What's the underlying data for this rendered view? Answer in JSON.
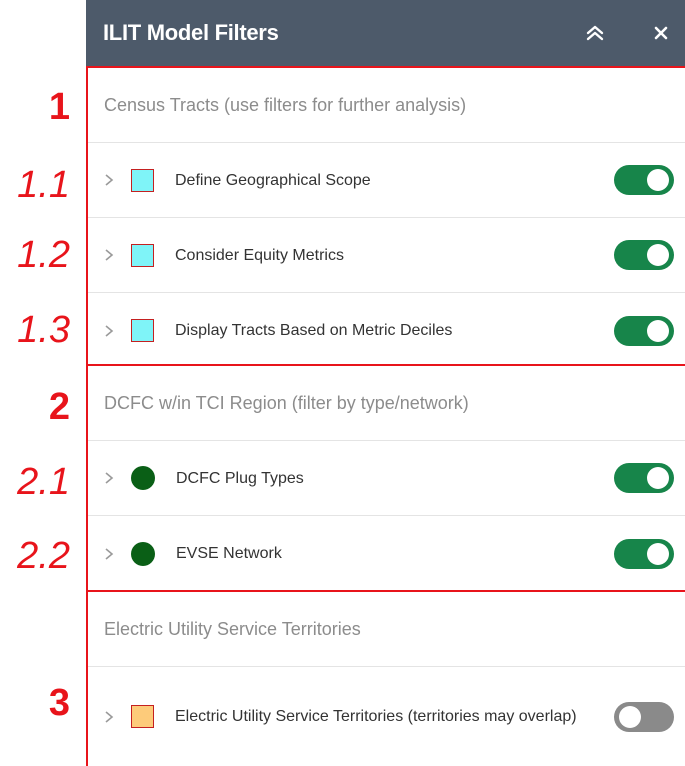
{
  "header": {
    "title": "ILIT Model Filters",
    "collapse_icon": "double-chevron-up-icon",
    "close_icon": "close-icon"
  },
  "annotations": [
    "1",
    "1.1",
    "1.2",
    "1.3",
    "2",
    "2.1",
    "2.2",
    "3"
  ],
  "colors": {
    "annotation": "#e8141b",
    "header_bg": "#4d5a6a",
    "toggle_on": "#17854a",
    "toggle_off": "#8a8a8a",
    "cyan_swatch": "#7ff4f8",
    "orange_swatch": "#fdcb7a",
    "green_dot": "#0a5f16"
  },
  "sections": [
    {
      "title": "Census Tracts (use filters for further analysis)",
      "layers": [
        {
          "label": "Define Geographical Scope",
          "enabled": true
        },
        {
          "label": "Consider Equity Metrics",
          "enabled": true
        },
        {
          "label": "Display Tracts Based on Metric Deciles",
          "enabled": true
        }
      ]
    },
    {
      "title": "DCFC w/in TCI Region (filter by type/network)",
      "layers": [
        {
          "label": "DCFC Plug Types",
          "enabled": true
        },
        {
          "label": "EVSE Network",
          "enabled": true
        }
      ]
    },
    {
      "title": "Electric Utility Service Territories",
      "layers": [
        {
          "label": "Electric Utility Service Territories (territories may overlap)",
          "enabled": false
        }
      ]
    }
  ]
}
